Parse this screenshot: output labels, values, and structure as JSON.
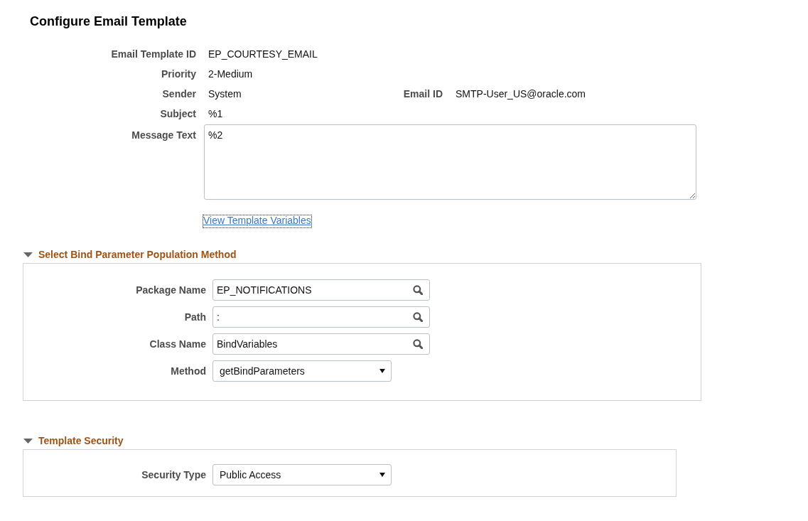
{
  "page": {
    "title": "Configure Email Template"
  },
  "details": {
    "rows": [
      {
        "label": "Email Template ID",
        "value": "EP_COURTESY_EMAIL"
      },
      {
        "label": "Priority",
        "value": "2-Medium"
      },
      {
        "label": "Sender",
        "value": "System",
        "extra": {
          "label": "Email ID",
          "value": "SMTP-User_US@oracle.com"
        }
      },
      {
        "label": "Subject",
        "value": "%1"
      }
    ],
    "message": {
      "label": "Message Text",
      "value": "%2"
    },
    "link": {
      "label": "View Template Variables",
      "focused": true
    }
  },
  "sections": [
    {
      "title": "Select Bind Parameter Population Method",
      "expanded": true,
      "fields": [
        {
          "kind": "lookup",
          "label": "Package Name",
          "value": "EP_NOTIFICATIONS"
        },
        {
          "kind": "lookup",
          "label": "Path",
          "value": ":"
        },
        {
          "kind": "lookup",
          "label": "Class Name",
          "value": "BindVariables"
        },
        {
          "kind": "dropdown",
          "label": "Method",
          "value": "getBindParameters"
        }
      ]
    },
    {
      "title": "Template Security",
      "expanded": true,
      "fields": [
        {
          "kind": "dropdown",
          "label": "Security Type",
          "value": "Public Access"
        }
      ]
    }
  ]
}
